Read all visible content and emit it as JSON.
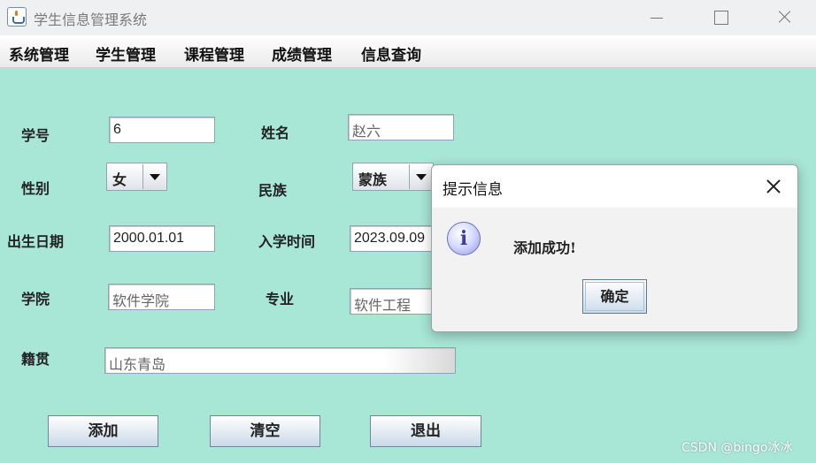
{
  "window": {
    "title": "学生信息管理系统",
    "icon": "java-cup-icon"
  },
  "menu": [
    "系统管理",
    "学生管理",
    "课程管理",
    "成绩管理",
    "信息查询"
  ],
  "form": {
    "student_id_label": "学号",
    "student_id_value": "6",
    "name_label": "姓名",
    "name_value": "赵六",
    "gender_label": "性别",
    "gender_value": "女",
    "ethnicity_label": "民族",
    "ethnicity_value": "蒙族",
    "birth_label": "出生日期",
    "birth_value": "2000.01.01",
    "enroll_label": "入学时间",
    "enroll_value": "2023.09.09",
    "college_label": "学院",
    "college_value": "软件学院",
    "major_label": "专业",
    "major_value": "软件工程",
    "hometown_label": "籍贯",
    "hometown_value": "山东青岛"
  },
  "buttons": {
    "add": "添加",
    "clear": "清空",
    "exit": "退出"
  },
  "dialog": {
    "title": "提示信息",
    "icon_glyph": "i",
    "message": "添加成功!",
    "ok": "确定"
  },
  "watermark": "CSDN @bingo冰冰",
  "colors": {
    "background": "#a8e6d6",
    "accent": "#8f98e6"
  }
}
